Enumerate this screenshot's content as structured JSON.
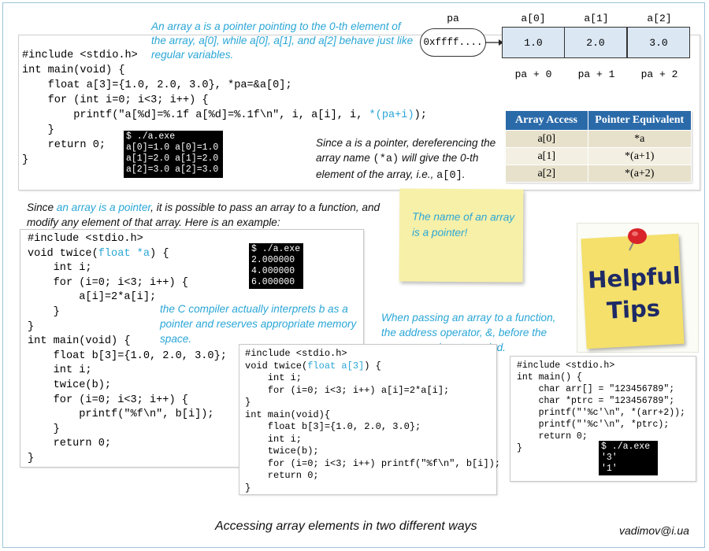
{
  "pointer_diagram": {
    "pa_label": "pa",
    "pa_value": "0xffff....",
    "cells": [
      {
        "header": "a[0]",
        "value": "1.0",
        "offset": "pa + 0"
      },
      {
        "header": "a[1]",
        "value": "2.0",
        "offset": "pa + 1"
      },
      {
        "header": "a[2]",
        "value": "3.0",
        "offset": "pa + 2"
      }
    ]
  },
  "notes": {
    "array_pointer": "An array a is a pointer pointing to the 0-th element of the array, a[0], while a[0], a[1], and a[2] behave just like regular variables.",
    "deref_1": "Since a is a pointer, dereferencing the array name ",
    "deref_code": "(*a)",
    "deref_2": " will give the 0-th element of the array, i.e., ",
    "deref_code2": "a[0]",
    "deref_3": ".",
    "pass_1": "Since ",
    "pass_link": "an array is a pointer",
    "pass_2": ", it is possible to pass an array to a function, and modify any element of that array. Here is an example:",
    "compiler": "the C compiler actually interprets b as a pointer and reserves appropriate memory space.",
    "address_op": "When passing an array to a function, the address operator, &, before the array name is not needed.",
    "sticky": "The name of an array is a pointer!",
    "helpful": "Helpful",
    "tips": "Tips",
    "caption": "Accessing array elements in two different ways",
    "author": "vadimov@i.ua"
  },
  "table": {
    "headers": [
      "Array Access",
      "Pointer Equivalent"
    ],
    "rows": [
      [
        "a[0]",
        "*a"
      ],
      [
        "a[1]",
        "*(a+1)"
      ],
      [
        "a[2]",
        "*(a+2)"
      ]
    ]
  },
  "code1": {
    "l1": "#include <stdio.h>",
    "l2": "int main(void) {",
    "l3": "    float a[3]={1.0, 2.0, 3.0}, *pa=&a[0];",
    "l4": "    for (int i=0; i<3; i++) {",
    "l5a": "        printf(\"a[%d]=%.1f a[%d]=%.1f\\n\", i, a[i], i, ",
    "l5b": "*(pa+i)",
    "l5c": ");",
    "l6": "    }",
    "l7": "    return 0;",
    "l8": "}",
    "term": "$ ./a.exe\na[0]=1.0 a[0]=1.0\na[1]=2.0 a[1]=2.0\na[2]=3.0 a[2]=3.0"
  },
  "code2": {
    "l1": "#include <stdio.h>",
    "l2a": "void twice(",
    "l2b": "float *a",
    "l2c": ") {",
    "l3": "    int i;",
    "l4": "    for (i=0; i<3; i++) {",
    "l5": "        a[i]=2*a[i];",
    "l6": "    }",
    "l7": "}",
    "l8": "int main(void) {",
    "l9": "    float b[3]={1.0, 2.0, 3.0};",
    "l10": "    int i;",
    "l11": "    twice(b);",
    "l12": "    for (i=0; i<3; i++) {",
    "l13": "        printf(\"%f\\n\", b[i]);",
    "l14": "    }",
    "l15": "    return 0;",
    "l16": "}",
    "term": "$ ./a.exe\n2.000000\n4.000000\n6.000000"
  },
  "code3": {
    "l1": "#include <stdio.h>",
    "l2a": "void twice(",
    "l2b": "float a[3]",
    "l2c": ") {",
    "l3": "    int i;",
    "l4": "    for (i=0; i<3; i++) a[i]=2*a[i];",
    "l5": "}",
    "l6": "int main(void){",
    "l7": "    float b[3]={1.0, 2.0, 3.0};",
    "l8": "    int i;",
    "l9": "    twice(b);",
    "l10": "    for (i=0; i<3; i++) printf(\"%f\\n\", b[i]);",
    "l11": "    return 0;",
    "l12": "}"
  },
  "code4": {
    "l1": "#include <stdio.h>",
    "l2": "int main() {",
    "l3": "    char arr[] = \"123456789\";",
    "l4": "    char *ptrc = \"123456789\";",
    "l5": "    printf(\"'%c'\\n\", *(arr+2));",
    "l6": "    printf(\"'%c'\\n\", *ptrc);",
    "l7": "    return 0;",
    "l8": "}",
    "term": "$ ./a.exe\n'3'\n'1'"
  },
  "colors": {
    "accent": "#2aa6d6",
    "table_header": "#2a6aa9",
    "sticky": "#f7f0a8",
    "tips_note": "#f4e06a"
  }
}
